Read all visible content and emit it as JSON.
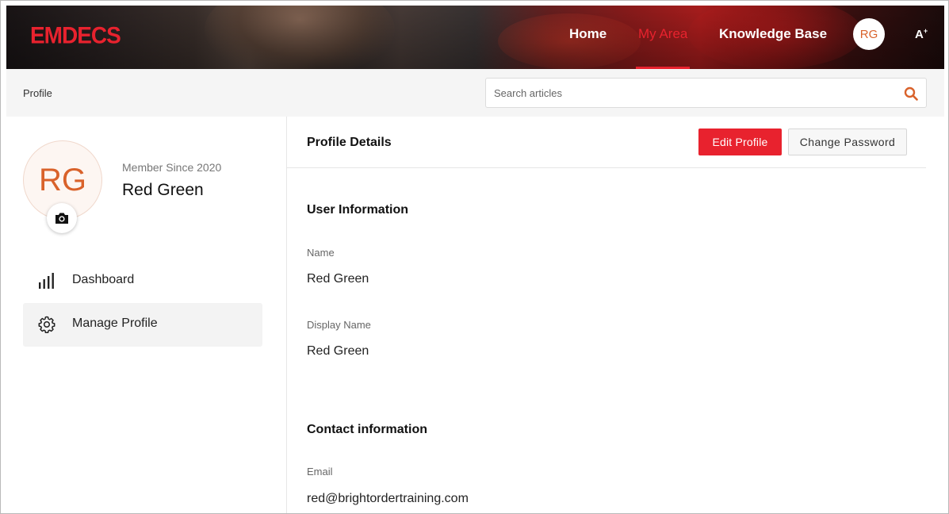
{
  "header": {
    "logo": "EMDECS",
    "nav": {
      "home": "Home",
      "my_area": "My Area",
      "knowledge_base": "Knowledge Base"
    },
    "avatar_initials": "RG",
    "font_toggle": "A",
    "font_toggle_sup": "+"
  },
  "subbar": {
    "breadcrumb": "Profile",
    "search_placeholder": "Search articles"
  },
  "profile_card": {
    "initials": "RG",
    "member_since": "Member Since 2020",
    "name": "Red Green"
  },
  "menu": {
    "items": [
      {
        "label": "Dashboard",
        "icon": "bar-chart-icon"
      },
      {
        "label": "Manage Profile",
        "icon": "gear-icon",
        "active": true
      }
    ]
  },
  "details": {
    "title": "Profile Details",
    "edit_button": "Edit Profile",
    "password_button": "Change Password",
    "user_info": {
      "title": "User Information",
      "name_label": "Name",
      "name_value": "Red Green",
      "display_label": "Display Name",
      "display_value": "Red Green"
    },
    "contact_info": {
      "title": "Contact information",
      "email_label": "Email",
      "email_value": "red@brightordertraining.com"
    }
  },
  "colors": {
    "brand_red": "#e8222e",
    "avatar_orange": "#d9622b",
    "search_icon": "#d9622b"
  }
}
